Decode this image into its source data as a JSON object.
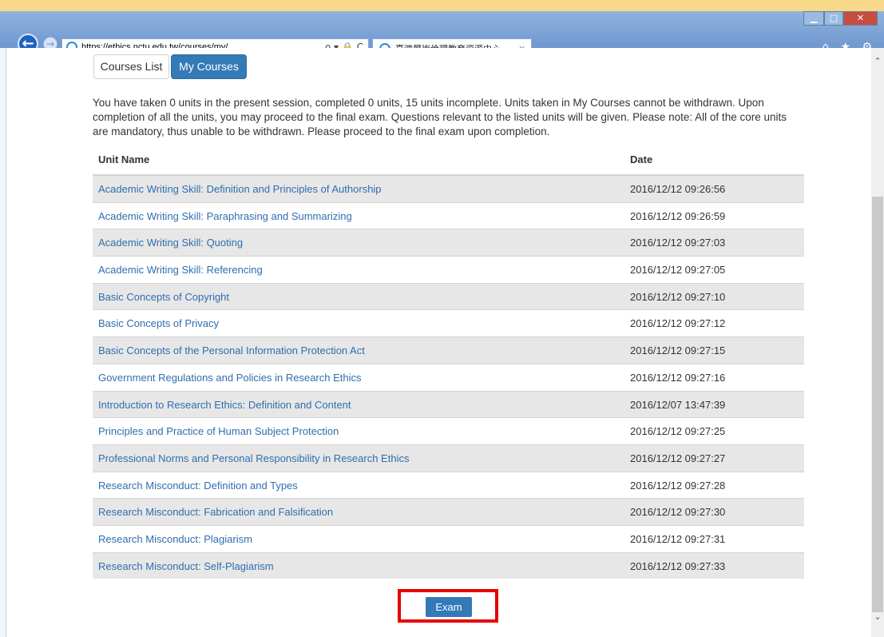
{
  "browser": {
    "url": "https://ethics.nctu.edu.tw/courses/my/",
    "tab_title": "臺灣學術倫理教育資源中心",
    "tab_close": "×",
    "addr_tools": "ρ ▾ 🔒 C",
    "right_tools": "⌂ ★ ⚙"
  },
  "tabs": {
    "courses_list": "Courses List",
    "my_courses": "My Courses"
  },
  "intro": "You have taken 0 units in the present session, completed 0 units, 15 units incomplete. Units taken in My Courses cannot be withdrawn. Upon completion of all the units, you may proceed to the final exam. Questions relevant to the listed units will be given. Please note: All of the core units are mandatory, thus unable to be withdrawn. Please proceed to the final exam upon completion.",
  "table": {
    "headers": {
      "unit_name": "Unit Name",
      "date": "Date"
    },
    "rows": [
      {
        "unit": "Academic Writing Skill: Definition and Principles of Authorship",
        "date": "2016/12/12 09:26:56"
      },
      {
        "unit": "Academic Writing Skill: Paraphrasing and Summarizing",
        "date": "2016/12/12 09:26:59"
      },
      {
        "unit": "Academic Writing Skill: Quoting",
        "date": "2016/12/12 09:27:03"
      },
      {
        "unit": "Academic Writing Skill: Referencing",
        "date": "2016/12/12 09:27:05"
      },
      {
        "unit": "Basic Concepts of Copyright",
        "date": "2016/12/12 09:27:10"
      },
      {
        "unit": "Basic Concepts of Privacy",
        "date": "2016/12/12 09:27:12"
      },
      {
        "unit": "Basic Concepts of the Personal Information Protection Act",
        "date": "2016/12/12 09:27:15"
      },
      {
        "unit": "Government Regulations and Policies in Research Ethics",
        "date": "2016/12/12 09:27:16"
      },
      {
        "unit": "Introduction to Research Ethics: Definition and Content",
        "date": "2016/12/07 13:47:39"
      },
      {
        "unit": "Principles and Practice of Human Subject Protection",
        "date": "2016/12/12 09:27:25"
      },
      {
        "unit": "Professional Norms and Personal Responsibility in Research Ethics",
        "date": "2016/12/12 09:27:27"
      },
      {
        "unit": "Research Misconduct: Definition and Types",
        "date": "2016/12/12 09:27:28"
      },
      {
        "unit": "Research Misconduct: Fabrication and Falsification",
        "date": "2016/12/12 09:27:30"
      },
      {
        "unit": "Research Misconduct: Plagiarism",
        "date": "2016/12/12 09:27:31"
      },
      {
        "unit": "Research Misconduct: Self-Plagiarism",
        "date": "2016/12/12 09:27:33"
      }
    ]
  },
  "exam_label": "Exam",
  "colors": {
    "primary": "#337ab7",
    "link": "#2f6eae",
    "highlight": "#ea0000"
  }
}
